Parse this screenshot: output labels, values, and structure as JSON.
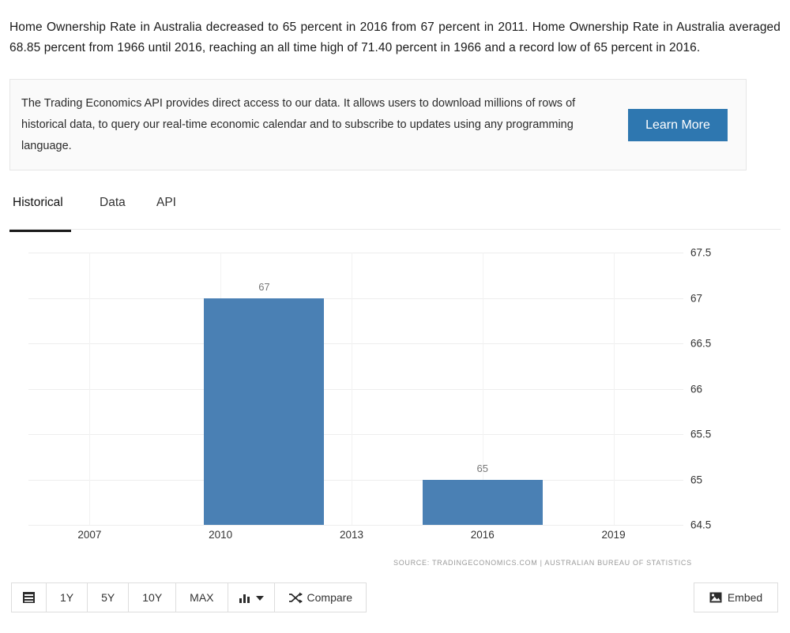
{
  "intro": {
    "paragraph": "Home Ownership Rate in Australia decreased to 65 percent in 2016 from 67 percent in 2011. Home Ownership Rate in Australia averaged 68.85 percent from 1966 until 2016, reaching an all time high of 71.40 percent in 1966 and a record low of 65 percent in 2016."
  },
  "api_banner": {
    "text": "The Trading Economics API provides direct access to our data. It allows users to download millions of rows of historical data, to query our real-time economic calendar and to subscribe to updates using any programming language.",
    "button_label": "Learn More",
    "button_color": "#2e77b0"
  },
  "tabs": [
    {
      "label": "Historical",
      "active": true
    },
    {
      "label": "Data",
      "active": false
    },
    {
      "label": "API",
      "active": false
    }
  ],
  "chart_data": {
    "type": "bar",
    "title": "",
    "xlabel": "",
    "ylabel": "",
    "categories": [
      "2011",
      "2016"
    ],
    "values": [
      67,
      65
    ],
    "data_labels": [
      "67",
      "65"
    ],
    "series": [
      {
        "name": "Home Ownership Rate",
        "values": [
          67,
          65
        ]
      }
    ],
    "ylim": [
      64.5,
      67.5
    ],
    "yticks": [
      "67.5",
      "67",
      "66.5",
      "66",
      "65.5",
      "65",
      "64.5"
    ],
    "ytick_values": [
      67.5,
      67,
      66.5,
      66,
      65.5,
      65,
      64.5
    ],
    "xticks": [
      "2007",
      "2010",
      "2013",
      "2016",
      "2019"
    ],
    "xtick_values": [
      2007,
      2010,
      2013,
      2016,
      2019
    ],
    "xlim": [
      2005.6,
      2020.6
    ],
    "grid": true,
    "legend": "none",
    "bar_color": "#4a80b4",
    "source": "SOURCE: TRADINGECONOMICS.COM | AUSTRALIAN BUREAU OF STATISTICS"
  },
  "toolbar": {
    "calendar_label": "",
    "ranges": [
      "1Y",
      "5Y",
      "10Y",
      "MAX"
    ],
    "chart_type_label": "",
    "compare_label": "Compare",
    "embed_label": "Embed"
  }
}
